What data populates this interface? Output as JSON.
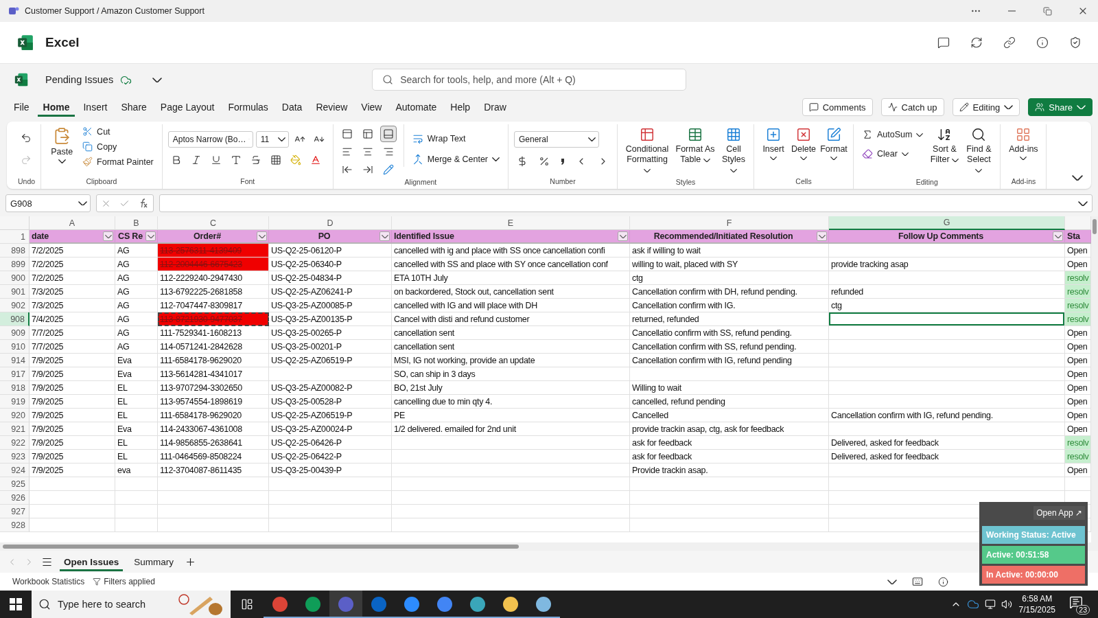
{
  "title_bar": {
    "title": "Customer Support / Amazon Customer Support"
  },
  "app": {
    "name": "Excel"
  },
  "document": {
    "name": "Pending Issues",
    "search_placeholder": "Search for tools, help, and more (Alt + Q)"
  },
  "menu_tabs": [
    {
      "label": "File",
      "selected": false
    },
    {
      "label": "Home",
      "selected": true
    },
    {
      "label": "Insert",
      "selected": false
    },
    {
      "label": "Share",
      "selected": false
    },
    {
      "label": "Page Layout",
      "selected": false
    },
    {
      "label": "Formulas",
      "selected": false
    },
    {
      "label": "Data",
      "selected": false
    },
    {
      "label": "Review",
      "selected": false
    },
    {
      "label": "View",
      "selected": false
    },
    {
      "label": "Automate",
      "selected": false
    },
    {
      "label": "Help",
      "selected": false
    },
    {
      "label": "Draw",
      "selected": false
    }
  ],
  "actions": [
    {
      "label": "Comments",
      "kind": "plain"
    },
    {
      "label": "Catch up",
      "kind": "plain"
    },
    {
      "label": "Editing",
      "kind": "dropdown"
    },
    {
      "label": "Share",
      "kind": "primary"
    }
  ],
  "ribbon": {
    "undo": {
      "label": "Undo",
      "tools": [
        {
          "disabled": false
        },
        {
          "disabled": true
        }
      ]
    },
    "clipboard": {
      "label": "Clipboard",
      "paste": "Paste",
      "items": [
        "Cut",
        "Copy",
        "Format Painter"
      ]
    },
    "font": {
      "label": "Font",
      "font_name": "Aptos Narrow (Bo…",
      "font_size": "11"
    },
    "alignment": {
      "label": "Alignment",
      "items": [
        "Wrap Text",
        "Merge & Center"
      ],
      "vertical": [
        {
          "selected": false
        },
        {
          "selected": false
        },
        {
          "selected": true
        }
      ]
    },
    "number": {
      "label": "Number",
      "format": "General"
    },
    "styles": {
      "label": "Styles",
      "items": [
        "Conditional Formatting",
        "Format As Table",
        "Cell Styles"
      ]
    },
    "cells": {
      "label": "Cells",
      "items": [
        "Insert",
        "Delete",
        "Format"
      ]
    },
    "editing": {
      "label": "Editing",
      "small": [
        "AutoSum",
        "Clear"
      ],
      "large": [
        "Sort & Filter",
        "Find & Select"
      ]
    },
    "addins": {
      "label": "Add-ins",
      "items": [
        "Add-ins"
      ]
    }
  },
  "formula_bar": {
    "name_box": "G908"
  },
  "sheet": {
    "column_letters": [
      {
        "label": "A",
        "selected": false
      },
      {
        "label": "B",
        "selected": false
      },
      {
        "label": "C",
        "selected": false
      },
      {
        "label": "D",
        "selected": false
      },
      {
        "label": "E",
        "selected": false
      },
      {
        "label": "F",
        "selected": false
      },
      {
        "label": "G",
        "selected": true
      }
    ],
    "header_row": "1",
    "headers": [
      "date",
      "CS Re",
      "Order#",
      "PO",
      "Identified Issue",
      "Recommended/Initiated Resolution",
      "Follow Up Comments",
      "Sta"
    ],
    "rows": [
      {
        "num": "898",
        "date": "7/2/2025",
        "rep": "AG",
        "order": "113-2576311-4139409",
        "po": "US-Q2-25-06120-P",
        "issue": "cancelled with ig and place with SS once cancellation confi",
        "resolution": "ask if willing to wait",
        "status": "Open",
        "flagged": true,
        "resolved": false,
        "selected": false
      },
      {
        "num": "899",
        "date": "7/2/2025",
        "rep": "AG",
        "order": "112-2004446-6675423",
        "po": "US-Q2-25-06340-P",
        "issue": "cancelled with SS and place with SY once cancellation conf",
        "resolution": "willing to wait, placed with SY",
        "follow_up": "provide tracking asap",
        "status": "Open",
        "flagged": true,
        "resolved": false,
        "selected": false
      },
      {
        "num": "900",
        "date": "7/2/2025",
        "rep": "AG",
        "order": "112-2229240-2947430",
        "po": "US-Q2-25-04834-P",
        "issue": "ETA 10TH July",
        "resolution": "ctg",
        "status": "resolv",
        "flagged": false,
        "resolved": true,
        "selected": false
      },
      {
        "num": "901",
        "date": "7/3/2025",
        "rep": "AG",
        "order": "113-6792225-2681858",
        "po": "US-Q2-25-AZ06241-P",
        "issue": "on backordered, Stock out, cancellation sent",
        "resolution": "Cancellation confirm with DH, refund pending.",
        "follow_up": "refunded",
        "status": "resolv",
        "flagged": false,
        "resolved": true,
        "selected": false
      },
      {
        "num": "902",
        "date": "7/3/2025",
        "rep": "AG",
        "order": "112-7047447-8309817",
        "po": "US-Q3-25-AZ00085-P",
        "issue": "cancelled with IG and will place with DH",
        "resolution": "Cancellation confirm with IG.",
        "follow_up": "ctg",
        "status": "resolv",
        "flagged": false,
        "resolved": true,
        "selected": false
      },
      {
        "num": "908",
        "date": "7/4/2025",
        "rep": "AG",
        "order": "113-8721930-9477037",
        "po": "US-Q3-25-AZ00135-P",
        "issue": "Cancel with disti and refund customer",
        "resolution": "returned, refunded",
        "status": "resolv",
        "flagged": true,
        "copied": true,
        "resolved": true,
        "selected": true
      },
      {
        "num": "909",
        "date": "7/7/2025",
        "rep": "AG",
        "order": "111-7529341-1608213",
        "po": "US-Q3-25-00265-P",
        "issue": "cancellation sent",
        "resolution": "Cancellatio confirm with SS, refund pending.",
        "status": "Open",
        "flagged": false,
        "resolved": false,
        "selected": false
      },
      {
        "num": "910",
        "date": "7/7/2025",
        "rep": "AG",
        "order": "114-0571241-2842628",
        "po": "US-Q3-25-00201-P",
        "issue": "cancellation sent",
        "resolution": "Cancellation confirm with SS, refund pending.",
        "status": "Open",
        "flagged": false,
        "resolved": false,
        "selected": false
      },
      {
        "num": "914",
        "date": "7/9/2025",
        "rep": "Eva",
        "order": "111-6584178-9629020",
        "po": "US-Q2-25-AZ06519-P",
        "issue": "MSI, IG not working, provide an update",
        "resolution": "Cancellation confirm with IG, refund pending",
        "status": "Open",
        "flagged": false,
        "resolved": false,
        "selected": false
      },
      {
        "num": "917",
        "date": "7/9/2025",
        "rep": "Eva",
        "order": "113-5614281-4341017",
        "issue": "SO, can ship in 3 days",
        "status": "Open",
        "flagged": false,
        "resolved": false,
        "selected": false
      },
      {
        "num": "918",
        "date": "7/9/2025",
        "rep": "EL",
        "order": "113-9707294-3302650",
        "po": "US-Q3-25-AZ00082-P",
        "issue": "BO, 21st July",
        "resolution": "Willing to wait",
        "status": "Open",
        "flagged": false,
        "resolved": false,
        "selected": false
      },
      {
        "num": "919",
        "date": "7/9/2025",
        "rep": "EL",
        "order": "113-9574554-1898619",
        "po": "US-Q3-25-00528-P",
        "issue": "cancelling due to min qty 4.",
        "resolution": "cancelled, refund pending",
        "status": "Open",
        "flagged": false,
        "resolved": false,
        "selected": false
      },
      {
        "num": "920",
        "date": "7/9/2025",
        "rep": "EL",
        "order": "111-6584178-9629020",
        "po": "US-Q2-25-AZ06519-P",
        "issue": "PE",
        "resolution": "Cancelled",
        "follow_up": "Cancellation confirm with IG, refund pending.",
        "status": "Open",
        "flagged": false,
        "resolved": false,
        "selected": false
      },
      {
        "num": "921",
        "date": "7/9/2025",
        "rep": "Eva",
        "order": "114-2433067-4361008",
        "po": "US-Q3-25-AZ00024-P",
        "issue": "1/2 delivered. emailed for 2nd unit",
        "resolution": "provide trackin asap, ctg, ask for feedback",
        "status": "Open",
        "flagged": false,
        "resolved": false,
        "selected": false
      },
      {
        "num": "922",
        "date": "7/9/2025",
        "rep": "EL",
        "order": "114-9856855-2638641",
        "po": "US-Q2-25-06426-P",
        "resolution": "ask for feedback",
        "follow_up": "Delivered, asked for feedback",
        "status": "resolv",
        "flagged": false,
        "resolved": true,
        "selected": false
      },
      {
        "num": "923",
        "date": "7/9/2025",
        "rep": "EL",
        "order": "111-0464569-8508224",
        "po": "US-Q2-25-06422-P",
        "resolution": "ask for feedback",
        "follow_up": "Delivered, asked for feedback",
        "status": "resolv",
        "flagged": false,
        "resolved": true,
        "selected": false
      },
      {
        "num": "924",
        "date": "7/9/2025",
        "rep": "eva",
        "order": "112-3704087-8611435",
        "po": "US-Q3-25-00439-P",
        "resolution": "Provide trackin asap.",
        "status": "Open",
        "flagged": false,
        "resolved": false,
        "selected": false
      }
    ],
    "empty_rows": [
      "925",
      "926",
      "927",
      "928"
    ]
  },
  "sheet_tabs": [
    {
      "label": "Open Issues",
      "selected": true
    },
    {
      "label": "Summary",
      "selected": false
    }
  ],
  "status_bar": {
    "items": [
      "Workbook Statistics",
      "Filters applied"
    ]
  },
  "tracker": {
    "open_label": "Open App ↗",
    "lines": [
      {
        "text": "Working Status: Active",
        "color": "#6ec3d0"
      },
      {
        "text": "Active: 00:51:58",
        "color": "#55c98a"
      },
      {
        "text": "In Active: 00:00:00",
        "color": "#ee6f66"
      }
    ]
  },
  "taskbar": {
    "search_placeholder": "Type here to search",
    "apps": [
      {
        "color": "#db4437",
        "selected": false
      },
      {
        "color": "#0f9d58",
        "selected": false
      },
      {
        "color": "#5b5fc7",
        "selected": true
      },
      {
        "color": "#0a64c4",
        "selected": false
      },
      {
        "color": "#2d8cff",
        "selected": false
      },
      {
        "color": "#4285f4",
        "selected": false
      },
      {
        "color": "#3aa6b9",
        "selected": false
      },
      {
        "color": "#f2c14e",
        "selected": false
      },
      {
        "color": "#7fb8e0",
        "selected": false
      }
    ],
    "time": "6:58 AM",
    "date": "7/15/2025",
    "notifications": "23"
  }
}
